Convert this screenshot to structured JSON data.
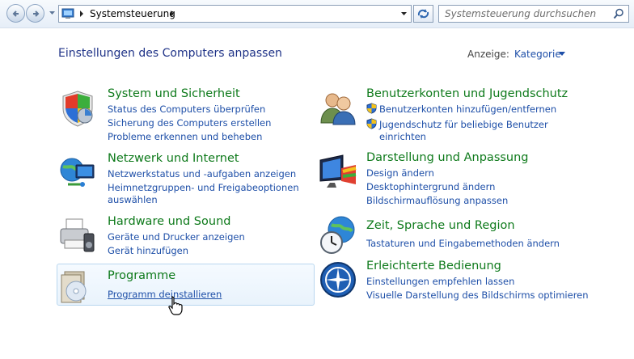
{
  "toolbar": {
    "breadcrumb": "Systemsteuerung",
    "search_placeholder": "Systemsteuerung durchsuchen"
  },
  "header": {
    "title": "Einstellungen des Computers anpassen",
    "view_label": "Anzeige:",
    "view_value": "Kategorie"
  },
  "categories": [
    {
      "title": "System und Sicherheit",
      "links": [
        "Status des Computers überprüfen",
        "Sicherung des Computers erstellen",
        "Probleme erkennen und beheben"
      ]
    },
    {
      "title": "Netzwerk und Internet",
      "links": [
        "Netzwerkstatus und -aufgaben anzeigen",
        "Heimnetzgruppen- und Freigabeoptionen",
        "auswählen"
      ]
    },
    {
      "title": "Hardware und Sound",
      "links": [
        "Geräte und Drucker anzeigen",
        "Gerät hinzufügen"
      ]
    },
    {
      "title": "Programme",
      "links": [
        "Programm deinstallieren"
      ]
    },
    {
      "title": "Benutzerkonten und Jugendschutz",
      "links": [
        "Benutzerkonten hinzufügen/entfernen",
        "Jugendschutz für beliebige Benutzer",
        "einrichten"
      ]
    },
    {
      "title": "Darstellung und Anpassung",
      "links": [
        "Design ändern",
        "Desktophintergrund ändern",
        "Bildschirmauflösung anpassen"
      ]
    },
    {
      "title": "Zeit, Sprache und Region",
      "links": [
        "Tastaturen und Eingabemethoden ändern"
      ]
    },
    {
      "title": "Erleichterte Bedienung",
      "links": [
        "Einstellungen empfehlen lassen",
        "Visuelle Darstellung des Bildschirms optimieren"
      ]
    }
  ]
}
